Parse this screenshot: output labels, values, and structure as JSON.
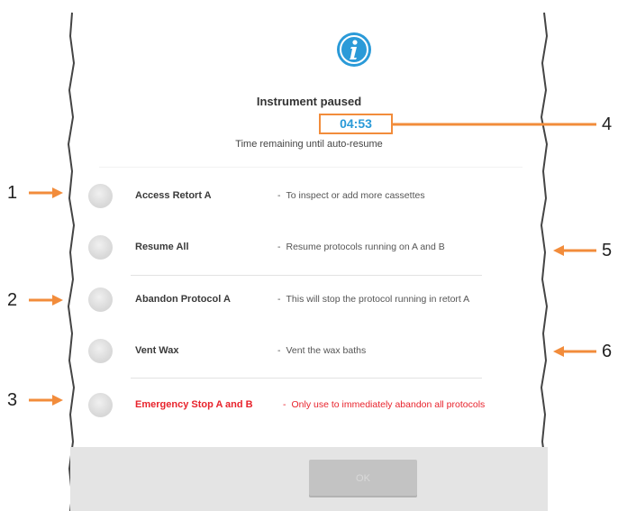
{
  "dialog": {
    "icon": "info-icon",
    "title": "Instrument paused",
    "timer": "04:53",
    "subtitle": "Time remaining until auto-resume",
    "options": [
      {
        "label": "Access Retort A",
        "desc": "To inspect or add more cassettes"
      },
      {
        "label": "Resume All",
        "desc": "Resume protocols running on A and B"
      },
      {
        "label": "Abandon Protocol A",
        "desc": "This will stop the protocol running in retort A"
      },
      {
        "label": "Vent Wax",
        "desc": "Vent the wax baths"
      },
      {
        "label": "Emergency Stop A and B",
        "desc": "Only use to immediately abandon all protocols"
      }
    ],
    "dash": "-",
    "ok_label": "OK"
  },
  "callouts": [
    "1",
    "2",
    "3",
    "4",
    "5",
    "6"
  ],
  "colors": {
    "accent": "#2a9ad8",
    "callout": "#f28c3b",
    "danger": "#e8232c",
    "footer": "#e4e4e4"
  }
}
